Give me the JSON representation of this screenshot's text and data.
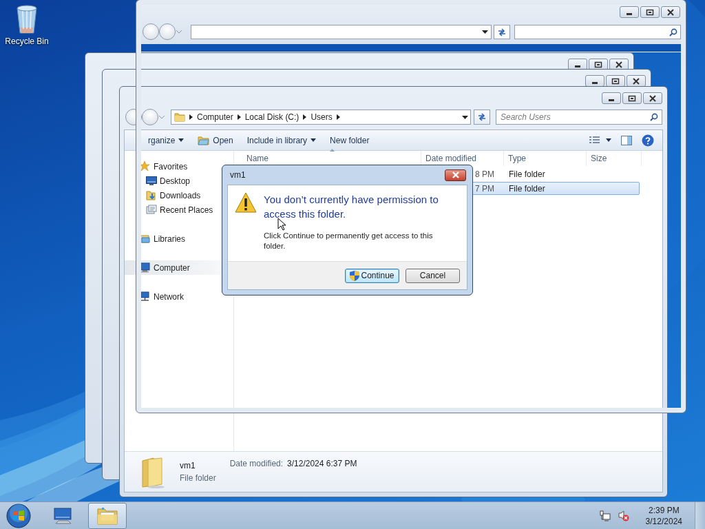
{
  "desktop": {
    "icons": [
      {
        "label": "Recycle Bin"
      }
    ]
  },
  "explorer": {
    "breadcrumbs": [
      "Computer",
      "Local Disk (C:)",
      "Users"
    ],
    "search": {
      "placeholder": "Search Users"
    },
    "toolbar": [
      {
        "label": "rganize",
        "kind": "menu"
      },
      {
        "label": "Open",
        "kind": "icon"
      },
      {
        "label": "Include in library",
        "kind": "menu"
      },
      {
        "label": "New folder",
        "kind": "plain"
      }
    ],
    "columns": [
      "Name",
      "Date modified",
      "Type",
      "Size"
    ],
    "sidebar": {
      "items": [
        {
          "label": "Favorites",
          "selected": false,
          "children": [
            {
              "label": "Desktop",
              "selected": false
            },
            {
              "label": "Downloads",
              "selected": false
            },
            {
              "label": "Recent Places",
              "selected": false
            }
          ]
        },
        {
          "label": "Libraries",
          "selected": false
        },
        {
          "label": "Computer",
          "selected": true
        },
        {
          "label": "Network",
          "selected": false
        }
      ]
    },
    "rows": [
      {
        "date_modified": "8 PM",
        "type": "File folder",
        "selected": false
      },
      {
        "date_modified": "7 PM",
        "type": "File folder",
        "selected": true
      }
    ],
    "details": {
      "name": "vm1",
      "type": "File folder",
      "date_label": "Date modified:",
      "date": "3/12/2024 6:37 PM"
    }
  },
  "dialog": {
    "title": "vm1",
    "instruction": "You don’t currently have permission to access this folder.",
    "content": "Click Continue to permanently get access to this folder.",
    "buttons": [
      {
        "label": "Continue",
        "kind": "elevated",
        "default": true
      },
      {
        "label": "Cancel",
        "kind": "plain",
        "default": false
      }
    ]
  },
  "taskbar": {
    "buttons": [
      {
        "kind": "computer",
        "active": false
      },
      {
        "kind": "explorer",
        "active": true
      }
    ],
    "volume_muted": true,
    "time": "2:39 PM",
    "date": "3/12/2024"
  }
}
